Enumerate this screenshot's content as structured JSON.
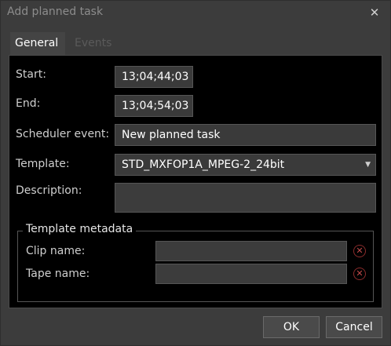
{
  "window": {
    "title": "Add planned task",
    "close_glyph": "✕"
  },
  "tabs": [
    {
      "label": "General",
      "active": true
    },
    {
      "label": "Events",
      "active": false
    }
  ],
  "form": {
    "start_label": "Start:",
    "start_value": "13;04;44;03",
    "end_label": "End:",
    "end_value": "13;04;54;03",
    "scheduler_event_label": "Scheduler event:",
    "scheduler_event_value": "New planned task",
    "template_label": "Template:",
    "template_value": "STD_MXFOP1A_MPEG-2_24bit",
    "description_label": "Description:",
    "description_value": ""
  },
  "template_metadata": {
    "title": "Template metadata",
    "clip_name_label": "Clip name:",
    "clip_name_value": "",
    "tape_name_label": "Tape name:",
    "tape_name_value": ""
  },
  "footer": {
    "ok_label": "OK",
    "cancel_label": "Cancel"
  },
  "icons": {
    "dropdown": "chevron-down-icon",
    "clear": "clear-circle-x-icon",
    "close": "close-icon"
  },
  "colors": {
    "panel_bg": "#000000",
    "window_bg": "#3c3c3c",
    "field_bg": "#3a3a3a",
    "clear_icon": "#c24a4a"
  }
}
